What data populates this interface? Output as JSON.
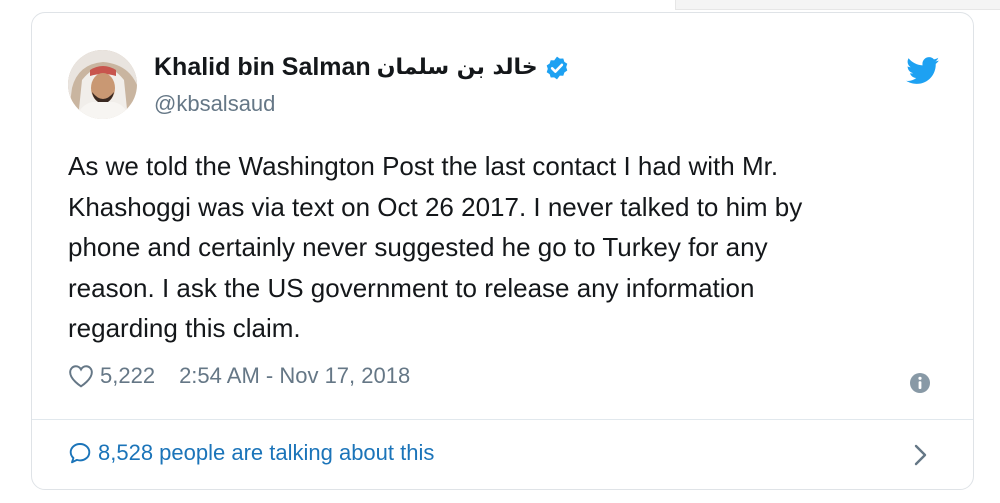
{
  "tweet": {
    "display_name": "Khalid bin Salman",
    "display_name_arabic": "خالد بن سلمان",
    "handle": "@kbsalsaud",
    "text_lines": [
      "As we told the Washington Post the last contact I had with Mr.",
      "Khashoggi was via text on Oct 26 2017. I never talked to him by",
      "phone and certainly never suggested he go to Turkey for any",
      "reason. I ask the US government to release any information",
      "regarding this claim."
    ],
    "like_count": "5,222",
    "timestamp": "2:54 AM - Nov 17, 2018",
    "talking_text": "8,528 people are talking about this"
  },
  "icons": {
    "verified": "verified-badge-icon",
    "brand": "twitter-bird-icon",
    "like": "heart-icon",
    "info": "info-icon",
    "reply": "speech-bubble-icon",
    "next": "chevron-right-icon"
  },
  "colors": {
    "brand_blue": "#1da1f2",
    "link_blue": "#1b74b9",
    "text_primary": "#14171a",
    "text_secondary": "#657786",
    "border": "#dfe3e7"
  }
}
